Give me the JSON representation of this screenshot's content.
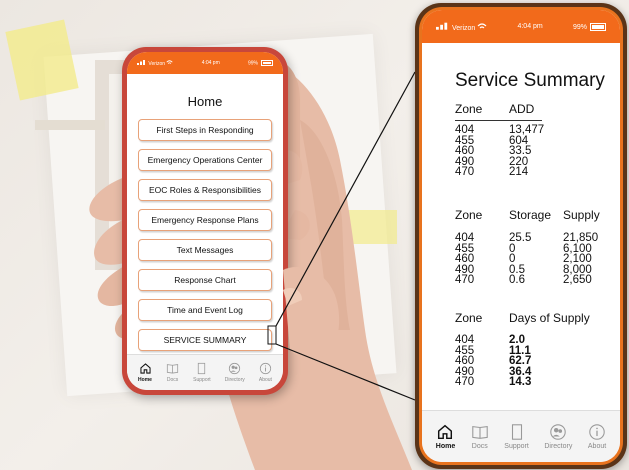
{
  "status": {
    "carrier": "Verizon",
    "time_small": "4:04 pm",
    "time_big": "4:04 pm",
    "battery": "99%"
  },
  "home": {
    "title": "Home",
    "buttons": [
      "First Steps in Responding",
      "Emergency Operations Center",
      "EOC Roles & Responsibilities",
      "Emergency Response Plans",
      "Text Messages",
      "Response Chart",
      "Time and Event Log",
      "SERVICE SUMMARY"
    ]
  },
  "tabs": [
    {
      "label": "Home",
      "icon": "home-icon"
    },
    {
      "label": "Docs",
      "icon": "book-icon"
    },
    {
      "label": "Support",
      "icon": "document-icon"
    },
    {
      "label": "Directory",
      "icon": "people-icon"
    },
    {
      "label": "About",
      "icon": "info-icon"
    }
  ],
  "summary": {
    "title": "Service Summary",
    "table1": {
      "h1": "Zone",
      "h2": "ADD",
      "zones": [
        "404",
        "455",
        "460",
        "490",
        "470"
      ],
      "add": [
        "13,477",
        "604",
        "33.5",
        "220",
        "214"
      ]
    },
    "table2": {
      "h1": "Zone",
      "h2": "Storage",
      "h3": "Supply",
      "zones": [
        "404",
        "455",
        "460",
        "490",
        "470"
      ],
      "storage": [
        "25.5",
        "0",
        "0",
        "0.5",
        "0.6"
      ],
      "supply": [
        "21,850",
        "6,100",
        "2,100",
        "8,000",
        "2,650"
      ]
    },
    "table3": {
      "h1": "Zone",
      "h2": "Days of Supply",
      "zones": [
        "404",
        "455",
        "460",
        "490",
        "470"
      ],
      "days": [
        "2.0",
        "11.1",
        "62.7",
        "36.4",
        "14.3"
      ]
    }
  },
  "colors": {
    "accent": "#f26a1b",
    "phone_case": "#c8473b",
    "button_border": "#e8a279"
  }
}
